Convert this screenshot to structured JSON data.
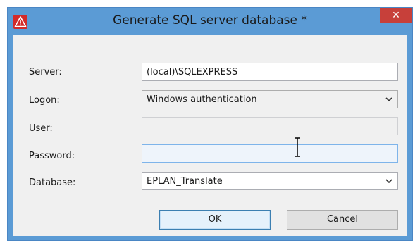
{
  "window": {
    "title": "Generate SQL server database *",
    "close_glyph": "✕",
    "app_icon": "warning-triangle-icon"
  },
  "form": {
    "server": {
      "label": "Server:",
      "value": "(local)\\SQLEXPRESS"
    },
    "logon": {
      "label": "Logon:",
      "value": "Windows authentication"
    },
    "user": {
      "label": "User:",
      "value": ""
    },
    "password": {
      "label": "Password:",
      "value": ""
    },
    "database": {
      "label": "Database:",
      "value": "EPLAN_Translate"
    }
  },
  "buttons": {
    "ok": "OK",
    "cancel": "Cancel"
  },
  "colors": {
    "titlebar": "#5b9bd5",
    "close_button": "#c7403a",
    "client_bg": "#f0f0f0"
  }
}
